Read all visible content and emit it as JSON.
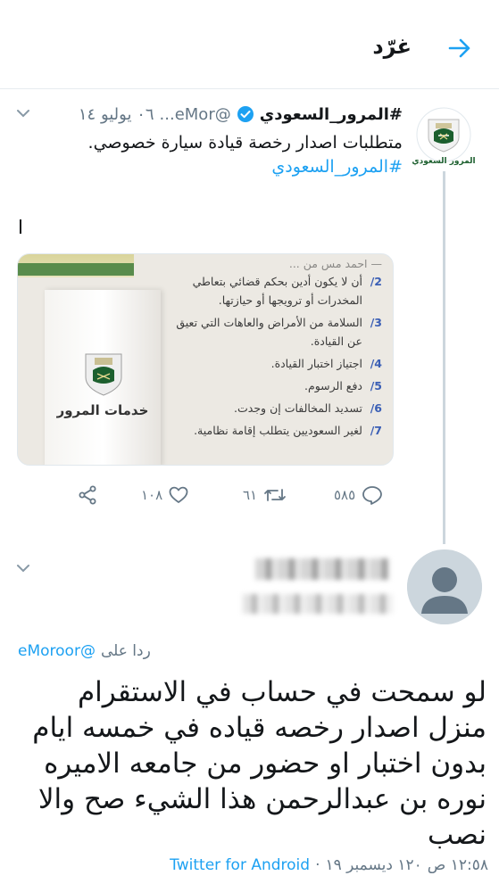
{
  "header": {
    "title": "غرّد",
    "back_icon": "arrow-right-icon"
  },
  "colors": {
    "accent": "#1da1f2",
    "muted": "#657786",
    "text": "#14171a",
    "divider": "#e6ecf0"
  },
  "parent_tweet": {
    "name": "#المرور_السعودي",
    "verified": true,
    "handle": "@eMor...",
    "date": "٠٦ يوليو ١٤",
    "text": "متطلبات اصدار رخصة قيادة سيارة خصوصي.",
    "hashtag": "#المرور_السعودي",
    "avatar_caption": "المرور السعودي",
    "card": {
      "side_label": "خدمات المرور",
      "items": [
        {
          "num": "",
          "text": "— أحمد مس من ...",
          "cont": ""
        },
        {
          "num": "2/",
          "text": "أن لا يكون أدين بحكم قضائي بتعاطي",
          "cont": "المخدرات أو ترويجها أو حيازتها."
        },
        {
          "num": "3/",
          "text": "السلامة من الأمراض والعاهات التي تعيق",
          "cont": "عن القيادة."
        },
        {
          "num": "4/",
          "text": "اجتياز اختبار القيادة.",
          "cont": ""
        },
        {
          "num": "5/",
          "text": "دفع الرسوم.",
          "cont": ""
        },
        {
          "num": "6/",
          "text": "تسديد المخالفات إن وجدت.",
          "cont": ""
        },
        {
          "num": "7/",
          "text": "لغير السعوديين يتطلب إقامة نظامية.",
          "cont": ""
        }
      ]
    },
    "actions": {
      "replies": "٥٨٥",
      "retweets": "٦١",
      "likes": "١٠٨"
    }
  },
  "reply_tweet": {
    "replying_label": "ردا على",
    "replying_to": "@eMoroor",
    "text": "لو سمحت في حساب في الاستقرام منزل اصدار رخصه قياده في خمسه ايام بدون اختبار او حضور من جامعه الاميره نوره بن عبدالرحمن هذا الشيء صح والا نصب",
    "time": "١٢:٥٨ ص",
    "separator": "·",
    "date": "١٢٠ ديسمبر ١٩",
    "source": "Twitter for Android"
  }
}
